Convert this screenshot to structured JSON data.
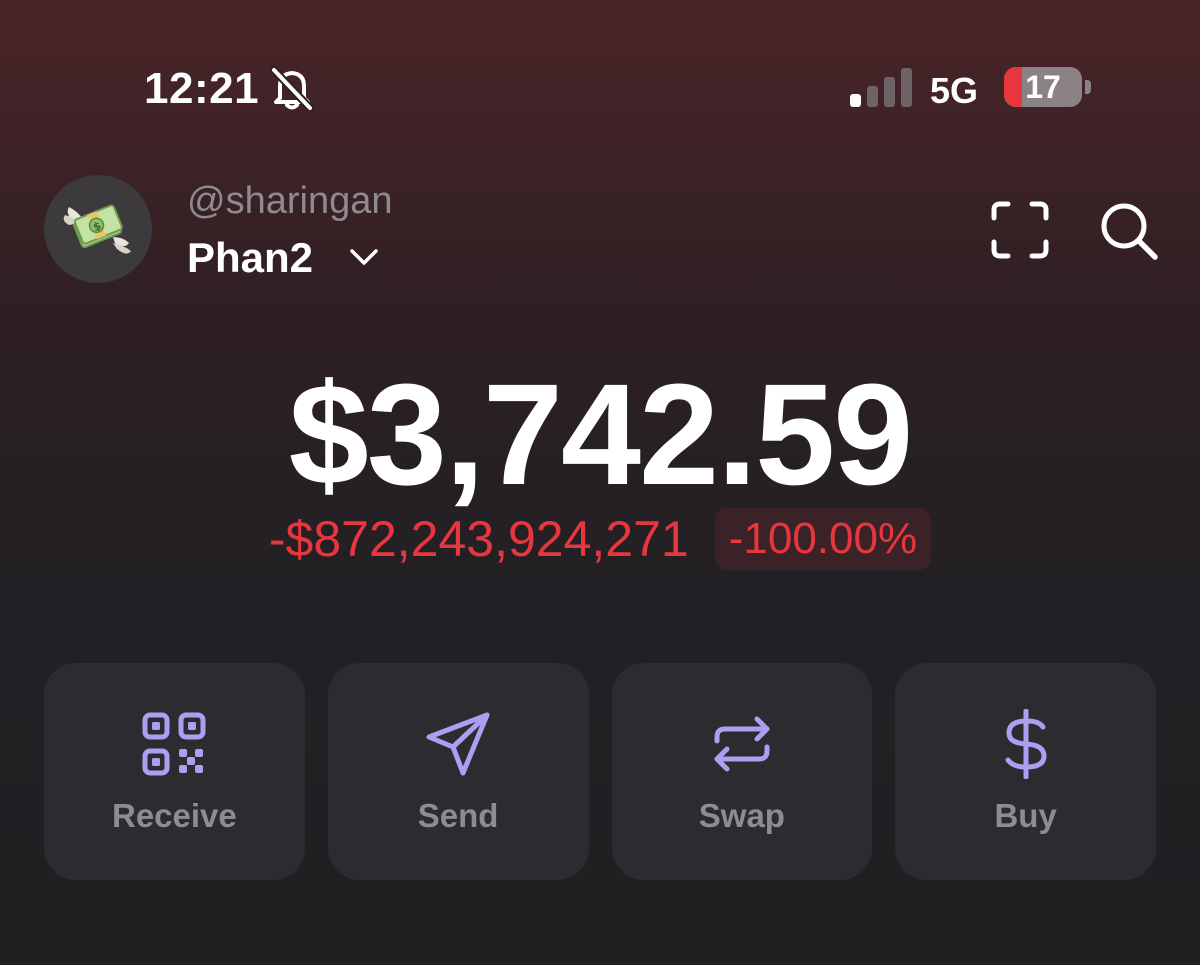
{
  "status_bar": {
    "time": "12:21",
    "silent_icon": "bell-slash-icon",
    "signal_bars_active": 1,
    "signal_bars_total": 4,
    "network": "5G",
    "battery_level": "17",
    "battery_fraction": 0.17
  },
  "header": {
    "avatar_icon": "money-with-wings-icon",
    "username": "@sharingan",
    "account_name": "Phan2",
    "scan_icon": "scan-frame-icon",
    "search_icon": "search-icon"
  },
  "balance": {
    "total": "$3,742.59",
    "change_amount": "-$872,243,924,271",
    "change_percent": "-100.00%"
  },
  "actions": [
    {
      "label": "Receive",
      "icon": "qr-code-icon"
    },
    {
      "label": "Send",
      "icon": "send-icon"
    },
    {
      "label": "Swap",
      "icon": "swap-icon"
    },
    {
      "label": "Buy",
      "icon": "dollar-icon"
    }
  ],
  "colors": {
    "accent": "#ab9ff2",
    "negative": "#e8363f",
    "card": "#2c2c30",
    "label": "#8f8c91"
  }
}
